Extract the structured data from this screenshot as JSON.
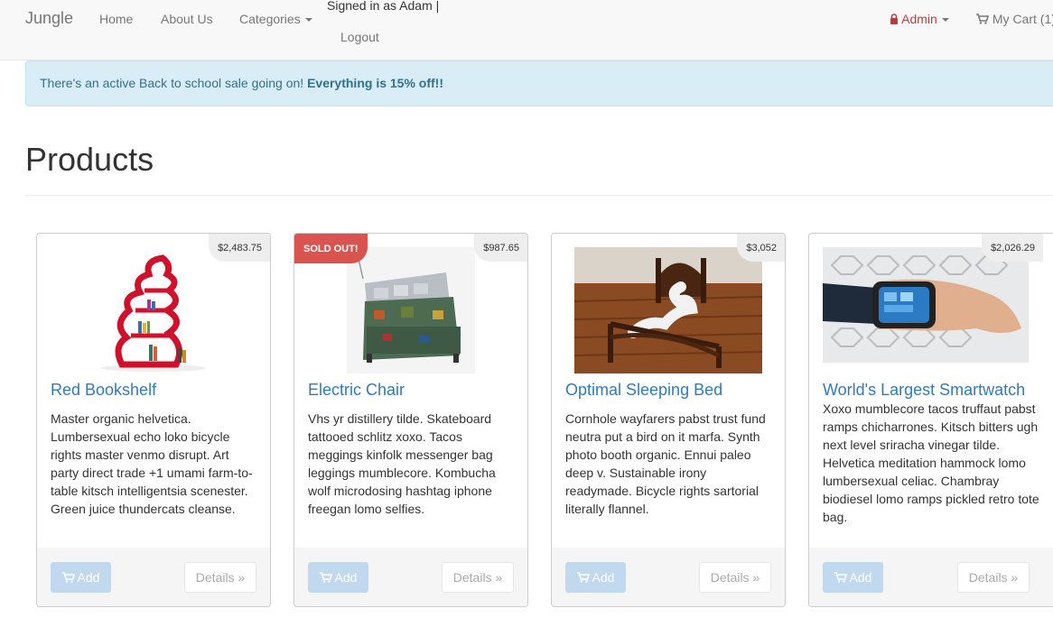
{
  "navbar": {
    "brand": "Jungle",
    "home": "Home",
    "about": "About Us",
    "categories": "Categories",
    "signed_in": "Signed in as Adam |",
    "logout": "Logout",
    "admin": "Admin",
    "cart": "My Cart (1)"
  },
  "alert": {
    "text": "There's an active Back to school sale going on! ",
    "emphasis": "Everything is 15% off!!"
  },
  "page": {
    "title": "Products"
  },
  "products": [
    {
      "name": "Red Bookshelf",
      "price": "$2,483.75",
      "description": "Master organic helvetica. Lumbersexual echo loko bicycle rights master venmo disrupt. Art party direct trade +1 umami farm-to-table kitsch intelligentsia scenester. Green juice thundercats cleanse.",
      "add_label": "Add",
      "details_label": "Details »"
    },
    {
      "name": "Electric Chair",
      "price": "$987.65",
      "badge": "SOLD OUT!",
      "description": "Vhs yr distillery tilde. Skateboard tattooed schlitz xoxo. Tacos meggings kinfolk messenger bag leggings mumblecore. Kombucha wolf microdosing hashtag iphone freegan lomo selfies.",
      "add_label": "Add",
      "details_label": "Details »"
    },
    {
      "name": "Optimal Sleeping Bed",
      "price": "$3,052",
      "description": "Cornhole wayfarers pabst trust fund neutra put a bird on it marfa. Synth photo booth organic. Ennui paleo deep v. Sustainable irony readymade. Bicycle rights sartorial literally flannel.",
      "add_label": "Add",
      "details_label": "Details »"
    },
    {
      "name": "World's Largest Smartwatch",
      "price": "$2,026.29",
      "description": "Xoxo mumblecore tacos truffaut pabst ramps chicharrones. Kitsch bitters ugh next level sriracha vinegar tilde. Helvetica meditation hammock lomo lumbersexual celiac. Chambray biodiesel lomo ramps pickled retro tote bag.",
      "add_label": "Add",
      "details_label": "Details »"
    }
  ]
}
